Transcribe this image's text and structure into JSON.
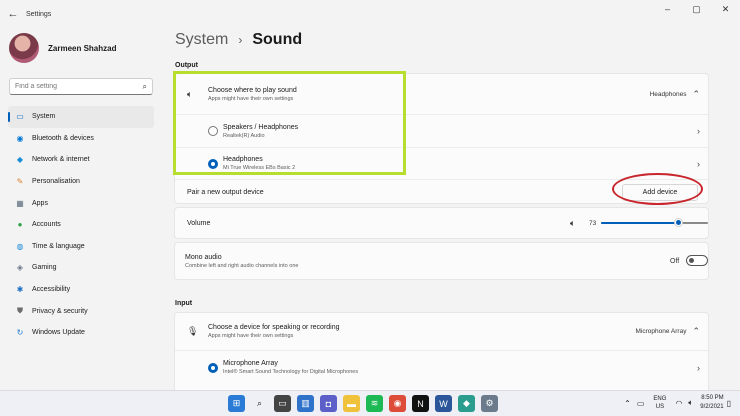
{
  "window": {
    "title": "Settings",
    "controls": [
      "–",
      "▢",
      "✕"
    ]
  },
  "profile": {
    "name": "Zarmeen Shahzad"
  },
  "search": {
    "placeholder": "Find a setting"
  },
  "nav": [
    {
      "label": "System",
      "icon": "system-icon",
      "glyph": "▭",
      "color": "#0067c0",
      "active": true
    },
    {
      "label": "Bluetooth & devices",
      "icon": "bluetooth-icon",
      "glyph": "◉",
      "color": "#0078d4"
    },
    {
      "label": "Network & internet",
      "icon": "network-icon",
      "glyph": "◆",
      "color": "#1a8fd8"
    },
    {
      "label": "Personalisation",
      "icon": "brush-icon",
      "glyph": "✎",
      "color": "#d9822b"
    },
    {
      "label": "Apps",
      "icon": "apps-icon",
      "glyph": "▦",
      "color": "#5a6b7b"
    },
    {
      "label": "Accounts",
      "icon": "accounts-icon",
      "glyph": "●",
      "color": "#2ea043"
    },
    {
      "label": "Time & language",
      "icon": "globe-icon",
      "glyph": "◍",
      "color": "#1b8ad8"
    },
    {
      "label": "Gaming",
      "icon": "gaming-icon",
      "glyph": "◈",
      "color": "#6a7787"
    },
    {
      "label": "Accessibility",
      "icon": "accessibility-icon",
      "glyph": "✱",
      "color": "#1b6fc2"
    },
    {
      "label": "Privacy & security",
      "icon": "shield-icon",
      "glyph": "⛊",
      "color": "#6d6d6d"
    },
    {
      "label": "Windows Update",
      "icon": "update-icon",
      "glyph": "↻",
      "color": "#1b7ad8"
    }
  ],
  "breadcrumb": {
    "parent": "System",
    "separator": "›",
    "current": "Sound"
  },
  "output": {
    "section_label": "Output",
    "choose": {
      "title": "Choose where to play sound",
      "subtitle": "Apps might have their own settings",
      "current": "Headphones"
    },
    "devices": [
      {
        "name": "Speakers / Headphones",
        "detail": "Realtek(R) Audio",
        "selected": false
      },
      {
        "name": "Headphones",
        "detail": "Mi True Wireless EBs Basic 2",
        "selected": true
      }
    ],
    "pair": {
      "label": "Pair a new output device",
      "button": "Add device"
    },
    "volume": {
      "label": "Volume",
      "value": "73"
    },
    "mono": {
      "title": "Mono audio",
      "subtitle": "Combine left and right audio channels into one",
      "state": "Off"
    }
  },
  "input": {
    "section_label": "Input",
    "choose": {
      "title": "Choose a device for speaking or recording",
      "subtitle": "Apps might have their own settings",
      "current": "Microphone Array"
    },
    "devices": [
      {
        "name": "Microphone Array",
        "detail": "Intel® Smart Sound Technology for Digital Microphones",
        "selected": true
      }
    ]
  },
  "annotations": {
    "highlight_color": "#b7de2f",
    "circle_color": "#c9252d"
  },
  "taskbar": {
    "apps": [
      {
        "name": "start-icon",
        "bg": "#2a7bd6",
        "glyph": "⊞"
      },
      {
        "name": "search-taskbar-icon",
        "bg": "transparent",
        "glyph": "⌕"
      },
      {
        "name": "task-view-icon",
        "bg": "#444",
        "glyph": "▭"
      },
      {
        "name": "widgets-icon",
        "bg": "#2f72c9",
        "glyph": "▥"
      },
      {
        "name": "chat-icon",
        "bg": "#5b5fc7",
        "glyph": "◘"
      },
      {
        "name": "file-explorer-icon",
        "bg": "#f0c23b",
        "glyph": "▬"
      },
      {
        "name": "spotify-icon",
        "bg": "#1db954",
        "glyph": "≋"
      },
      {
        "name": "chrome-icon",
        "bg": "#dd4b39",
        "glyph": "◉"
      },
      {
        "name": "netflix-icon",
        "bg": "#111",
        "glyph": "N"
      },
      {
        "name": "word-icon",
        "bg": "#2b579a",
        "glyph": "W"
      },
      {
        "name": "maps-icon",
        "bg": "#2a9d8f",
        "glyph": "◆"
      },
      {
        "name": "settings-taskbar-icon",
        "bg": "#6b7b8b",
        "glyph": "⚙"
      }
    ],
    "lang_top": "ENG",
    "lang_bottom": "US",
    "time": "8:50 PM",
    "date": "9/2/2021"
  }
}
